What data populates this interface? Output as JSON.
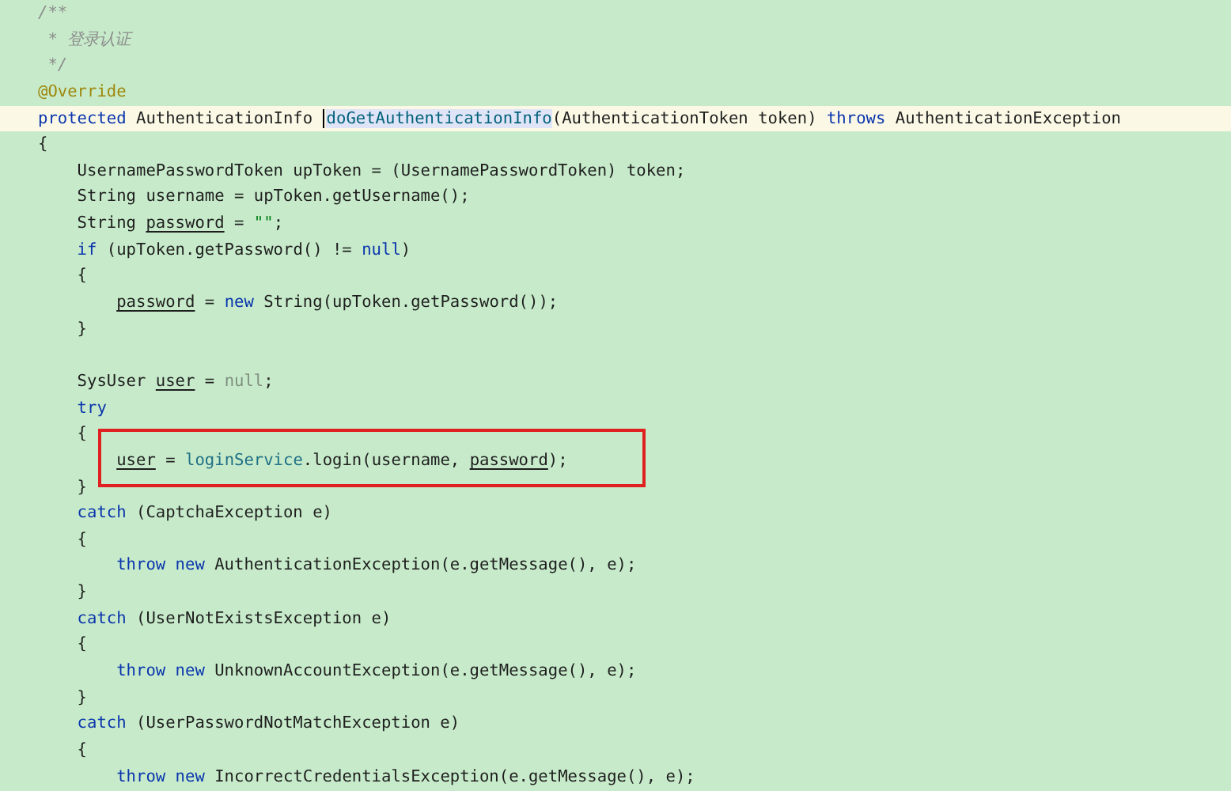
{
  "editor": {
    "lines": [
      {
        "kind": "code",
        "tokens": [
          {
            "t": "/**",
            "kind": "comment"
          }
        ]
      },
      {
        "kind": "code",
        "tokens": [
          {
            "t": " * 登录认证",
            "kind": "comment"
          }
        ]
      },
      {
        "kind": "code",
        "tokens": [
          {
            "t": " */",
            "kind": "comment"
          }
        ]
      },
      {
        "kind": "code",
        "tokens": [
          {
            "t": "@Override",
            "kind": "annotation"
          }
        ]
      },
      {
        "kind": "code",
        "current": true,
        "tokens": [
          {
            "t": "protected",
            "kind": "keyword"
          },
          {
            "t": " AuthenticationInfo ",
            "kind": "plain"
          },
          {
            "t": "doGetAuthenticationInfo",
            "kind": "method",
            "caret": true
          },
          {
            "t": "(AuthenticationToken token) ",
            "kind": "plain"
          },
          {
            "t": "throws",
            "kind": "keyword"
          },
          {
            "t": " AuthenticationException",
            "kind": "plain"
          }
        ]
      },
      {
        "kind": "code",
        "tokens": [
          {
            "t": "{",
            "kind": "plain"
          }
        ],
        "children": [
          {
            "kind": "code",
            "tokens": [
              {
                "t": "UsernamePasswordToken upToken = (UsernamePasswordToken) token;",
                "kind": "plain"
              }
            ]
          },
          {
            "kind": "code",
            "tokens": [
              {
                "t": "String username = upToken.getUsername();",
                "kind": "plain"
              }
            ]
          },
          {
            "kind": "code",
            "tokens": [
              {
                "t": "String ",
                "kind": "plain"
              },
              {
                "t": "password",
                "kind": "reassigned"
              },
              {
                "t": " = ",
                "kind": "plain"
              },
              {
                "t": "\"\"",
                "kind": "string"
              },
              {
                "t": ";",
                "kind": "plain"
              }
            ]
          },
          {
            "kind": "code",
            "tokens": [
              {
                "t": "if",
                "kind": "keyword"
              },
              {
                "t": " (upToken.getPassword() != ",
                "kind": "plain"
              },
              {
                "t": "null",
                "kind": "keyword"
              },
              {
                "t": ")",
                "kind": "plain"
              }
            ]
          },
          {
            "kind": "code",
            "tokens": [
              {
                "t": "{",
                "kind": "plain"
              }
            ],
            "children": [
              {
                "kind": "code",
                "tokens": [
                  {
                    "t": "password",
                    "kind": "reassigned"
                  },
                  {
                    "t": " = ",
                    "kind": "plain"
                  },
                  {
                    "t": "new",
                    "kind": "keyword"
                  },
                  {
                    "t": " String(upToken.getPassword());",
                    "kind": "plain"
                  }
                ]
              }
            ]
          },
          {
            "kind": "code",
            "tokens": [
              {
                "t": "}",
                "kind": "plain"
              }
            ]
          },
          {
            "kind": "blank"
          },
          {
            "kind": "code",
            "tokens": [
              {
                "t": "SysUser ",
                "kind": "plain"
              },
              {
                "t": "user",
                "kind": "reassigned"
              },
              {
                "t": " = ",
                "kind": "plain"
              },
              {
                "t": "null",
                "kind": "unused"
              },
              {
                "t": ";",
                "kind": "plain"
              }
            ]
          },
          {
            "kind": "code",
            "tokens": [
              {
                "t": "try",
                "kind": "keyword"
              }
            ]
          },
          {
            "kind": "code",
            "tokens": [
              {
                "t": "{",
                "kind": "plain"
              }
            ],
            "children": [
              {
                "kind": "code",
                "boxed": true,
                "tokens": [
                  {
                    "t": "user",
                    "kind": "reassigned"
                  },
                  {
                    "t": " = ",
                    "kind": "plain"
                  },
                  {
                    "t": "loginService",
                    "kind": "field"
                  },
                  {
                    "t": ".login(username, ",
                    "kind": "plain"
                  },
                  {
                    "t": "password",
                    "kind": "reassigned"
                  },
                  {
                    "t": ");",
                    "kind": "plain"
                  }
                ]
              }
            ]
          },
          {
            "kind": "code",
            "tokens": [
              {
                "t": "}",
                "kind": "plain"
              }
            ]
          },
          {
            "kind": "code",
            "tokens": [
              {
                "t": "catch",
                "kind": "keyword"
              },
              {
                "t": " (CaptchaException e)",
                "kind": "plain"
              }
            ]
          },
          {
            "kind": "code",
            "tokens": [
              {
                "t": "{",
                "kind": "plain"
              }
            ],
            "children": [
              {
                "kind": "code",
                "tokens": [
                  {
                    "t": "throw ",
                    "kind": "keyword"
                  },
                  {
                    "t": "new",
                    "kind": "keyword"
                  },
                  {
                    "t": " AuthenticationException(e.getMessage(), e);",
                    "kind": "plain"
                  }
                ]
              }
            ]
          },
          {
            "kind": "code",
            "tokens": [
              {
                "t": "}",
                "kind": "plain"
              }
            ]
          },
          {
            "kind": "code",
            "tokens": [
              {
                "t": "catch",
                "kind": "keyword"
              },
              {
                "t": " (UserNotExistsException e)",
                "kind": "plain"
              }
            ]
          },
          {
            "kind": "code",
            "tokens": [
              {
                "t": "{",
                "kind": "plain"
              }
            ],
            "children": [
              {
                "kind": "code",
                "tokens": [
                  {
                    "t": "throw ",
                    "kind": "keyword"
                  },
                  {
                    "t": "new",
                    "kind": "keyword"
                  },
                  {
                    "t": " UnknownAccountException(e.getMessage(), e);",
                    "kind": "plain"
                  }
                ]
              }
            ]
          },
          {
            "kind": "code",
            "tokens": [
              {
                "t": "}",
                "kind": "plain"
              }
            ]
          },
          {
            "kind": "code",
            "tokens": [
              {
                "t": "catch",
                "kind": "keyword"
              },
              {
                "t": " (UserPasswordNotMatchException e)",
                "kind": "plain"
              }
            ]
          },
          {
            "kind": "code",
            "tokens": [
              {
                "t": "{",
                "kind": "plain"
              }
            ],
            "children": [
              {
                "kind": "code",
                "tokens": [
                  {
                    "t": "throw ",
                    "kind": "keyword"
                  },
                  {
                    "t": "new",
                    "kind": "keyword"
                  },
                  {
                    "t": " IncorrectCredentialsException(e.getMessage(), e);",
                    "kind": "plain"
                  }
                ]
              }
            ]
          }
        ]
      }
    ]
  }
}
